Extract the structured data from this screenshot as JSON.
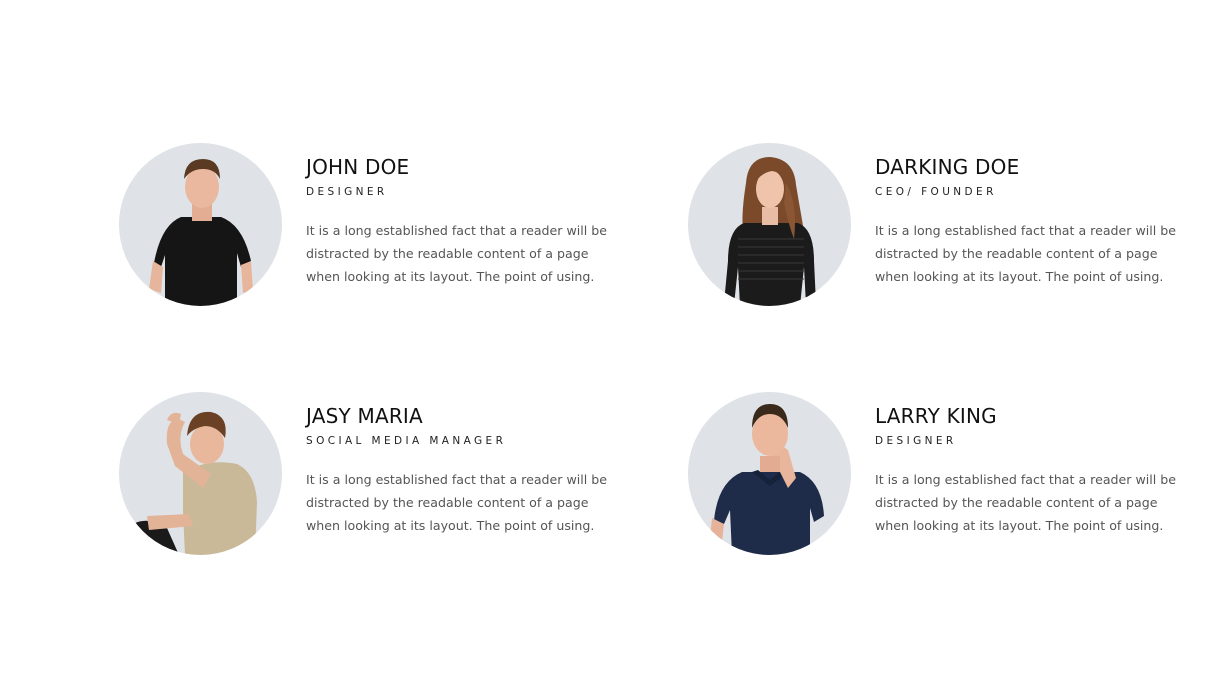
{
  "team": [
    {
      "name": "JOHN DOE",
      "role": "DESIGNER",
      "bio": "It is a long established fact that a reader will be distracted by the readable content of a page when looking at its layout. The point of using."
    },
    {
      "name": "DARKING DOE",
      "role": "CEO/ FOUNDER",
      "bio": "It is a long established fact that a reader will be distracted by the readable content of a page when looking at its layout. The point of using."
    },
    {
      "name": "JASY MARIA",
      "role": "SOCIAL MEDIA MANAGER",
      "bio": "It is a long established fact that a reader will be distracted by the readable content of a page when looking at its layout. The point of using."
    },
    {
      "name": "LARRY KING",
      "role": "DESIGNER",
      "bio": "It is a long established fact that a reader will be distracted by the readable content of a page when looking at its layout. The point of using."
    }
  ],
  "colors": {
    "avatar_background": "#dfe3e7",
    "name_text": "#111111",
    "bio_text": "#555555"
  }
}
